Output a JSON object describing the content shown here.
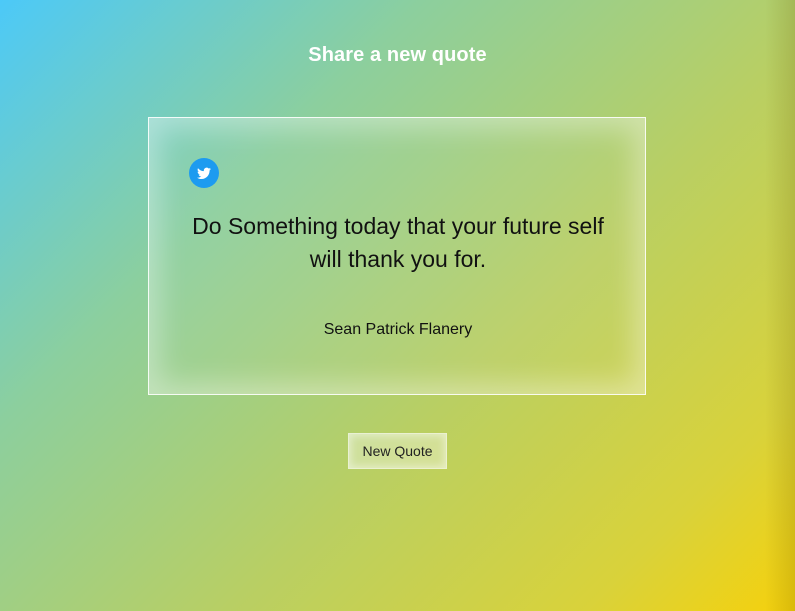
{
  "header": {
    "title": "Share a new quote"
  },
  "quote": {
    "text": "Do Something today that your future self will thank you for.",
    "author": "Sean Patrick Flanery",
    "share_icon": "twitter-icon"
  },
  "actions": {
    "new_quote_label": "New Quote"
  },
  "colors": {
    "twitter_blue": "#1d9bf0",
    "heading_text": "#ffffff",
    "body_text": "#111111",
    "gradient_start": "#4cc9f8",
    "gradient_end": "#f6d10b"
  }
}
